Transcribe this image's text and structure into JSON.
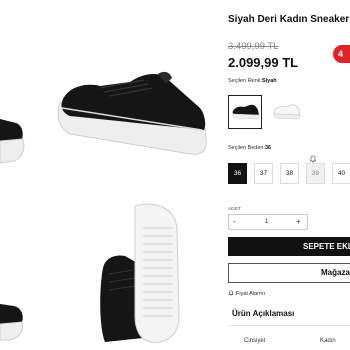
{
  "product": {
    "title": "Siyah Deri Kadın Sneaker -",
    "old_price": "3.499,99 TL",
    "price": "2.099,99 TL",
    "discount_badge": "4"
  },
  "color": {
    "label": "Seçilen Renk:",
    "selected": "Siyah",
    "options": [
      "Siyah",
      "Beyaz"
    ]
  },
  "size": {
    "label": "Seçilen Beden:",
    "selected": "36",
    "options": [
      "36",
      "37",
      "38",
      "39",
      "40"
    ],
    "unavailable": [
      "39"
    ]
  },
  "quantity": {
    "label": "ADET",
    "minus": "-",
    "value": "1",
    "plus": "+"
  },
  "actions": {
    "add_to_cart": "SEPETE EKL",
    "store": "Mağaza"
  },
  "price_alarm": "Fiyat Alarmı",
  "description": {
    "title": "Ürün Açıklaması",
    "spec_key": "Cinsiyet",
    "spec_value": "Kadın"
  },
  "colors": {
    "primary": "#111111",
    "discount": "#e2222a",
    "muted": "#888888"
  }
}
